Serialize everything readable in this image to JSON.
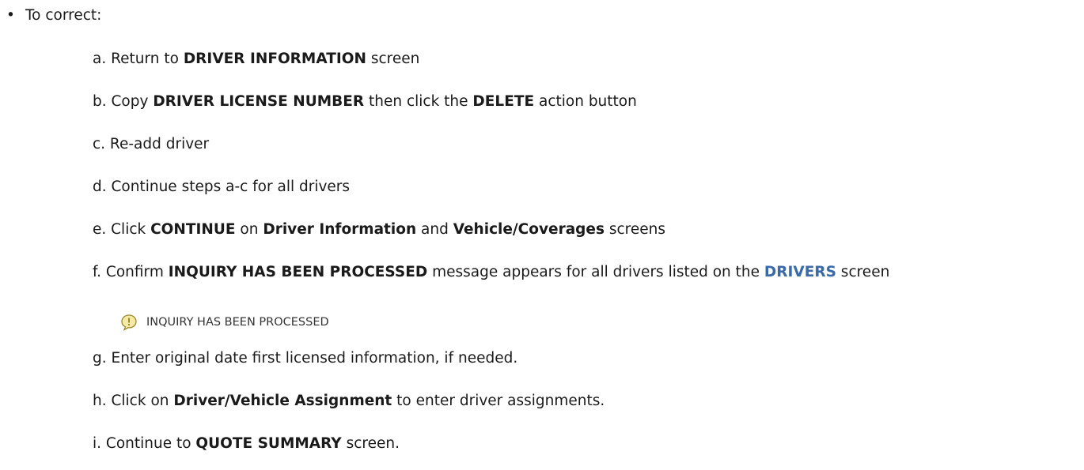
{
  "bullet": {
    "symbol": "•",
    "text": "To correct:"
  },
  "steps": {
    "a": {
      "prefix": "a. Return to ",
      "b1": "DRIVER INFORMATION",
      "suffix": " screen"
    },
    "b": {
      "prefix": "b. Copy ",
      "b1": "DRIVER LICENSE NUMBER",
      "mid": " then click the ",
      "b2": "DELETE",
      "suffix": " action button"
    },
    "c": {
      "text": "c.  Re-add driver"
    },
    "d": {
      "text": "d.  Continue steps a-c  for all drivers"
    },
    "e": {
      "prefix": "e. Click ",
      "b1": "CONTINUE",
      "mid1": " on ",
      "b2": "Driver Information",
      "mid2": " and ",
      "b3": "Vehicle/Coverages",
      "suffix": " screens"
    },
    "f": {
      "prefix": "f.  Confirm ",
      "b1": "INQUIRY HAS BEEN PROCESSED",
      "mid": " message appears for all drivers listed on the ",
      "b2": "DRIVERS",
      "suffix": " screen"
    },
    "g": {
      "text": "g.  Enter original date first licensed information, if needed."
    },
    "h": {
      "prefix": "h. Click on ",
      "b1": "Driver/Vehicle Assignment",
      "suffix": " to enter driver assignments."
    },
    "i": {
      "prefix": "i.  Continue to ",
      "b1": "QUOTE SUMMARY",
      "suffix": " screen."
    }
  },
  "message_box": {
    "icon": "info-exclamation-icon",
    "text": "INQUIRY HAS BEEN PROCESSED"
  },
  "colors": {
    "link_blue": "#3a6aa8",
    "icon_yellow": "#f5e9a8",
    "icon_olive": "#9b8a2a"
  }
}
